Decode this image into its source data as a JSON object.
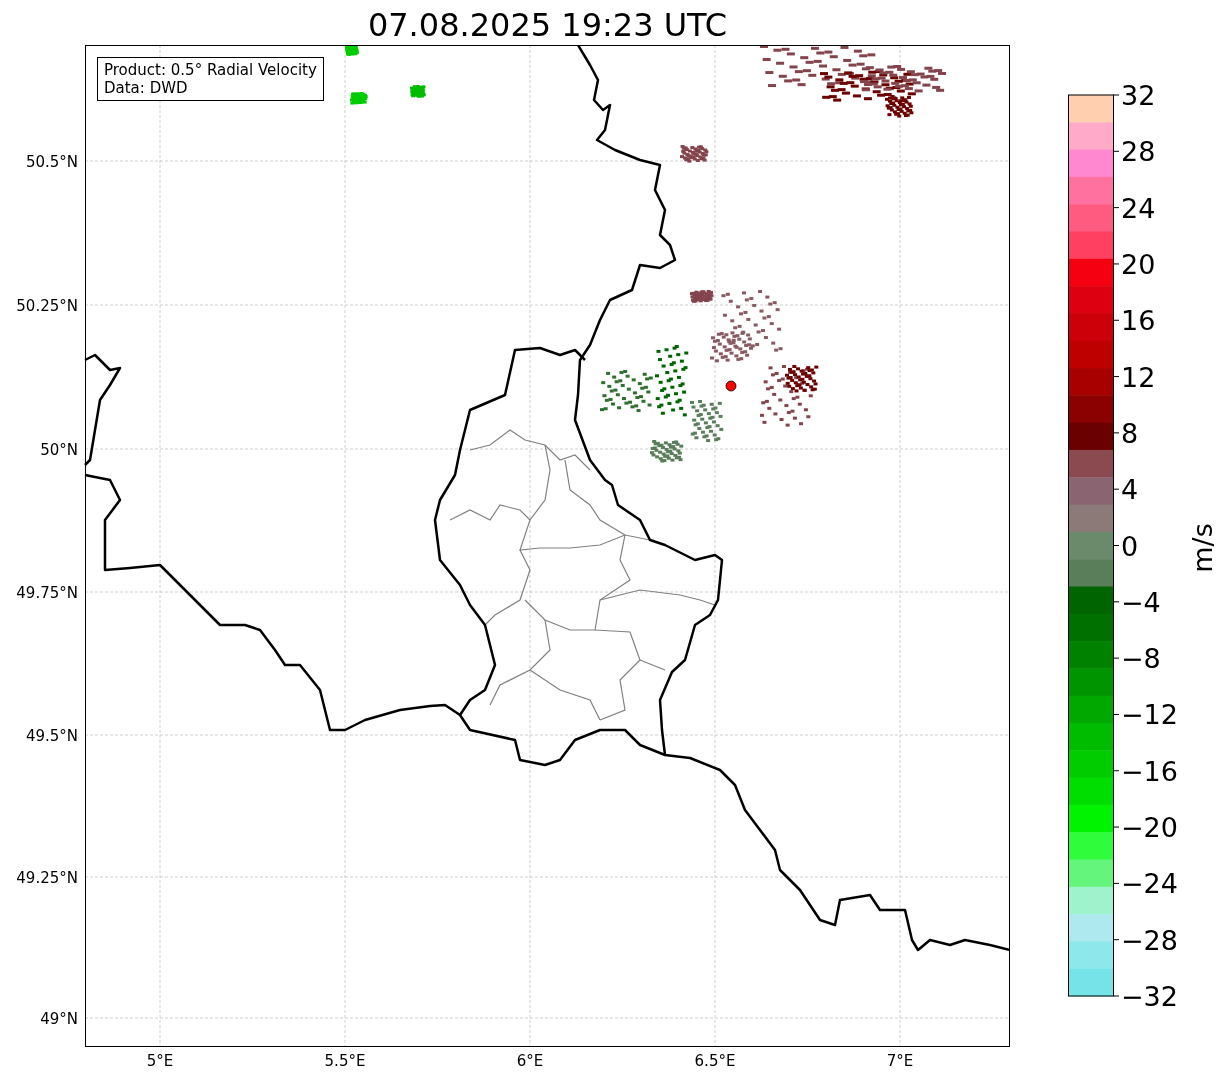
{
  "title": "07.08.2025 19:23 UTC",
  "map": {
    "legend": [
      "Product: 0.5° Radial Velocity",
      "Data: DWD"
    ],
    "lat_ticks": [
      "50.5°N",
      "50.25°N",
      "50°N",
      "49.75°N",
      "49.5°N",
      "49.25°N",
      "49°N"
    ],
    "lon_ticks": [
      "5°E",
      "5.5°E",
      "6°E",
      "6.5°E",
      "7°E"
    ]
  },
  "colorbar": {
    "label": "m/s",
    "ticks": [
      "32",
      "28",
      "24",
      "20",
      "16",
      "12",
      "8",
      "4",
      "0",
      "−4",
      "−8",
      "−12",
      "−16",
      "−20",
      "−24",
      "−28",
      "−32"
    ],
    "bands": [
      {
        "color": "#ffcfb0"
      },
      {
        "color": "#ffaac8"
      },
      {
        "color": "#ff88d0"
      },
      {
        "color": "#ff72a0"
      },
      {
        "color": "#ff5a80"
      },
      {
        "color": "#ff4060"
      },
      {
        "color": "#f50010"
      },
      {
        "color": "#dc0010"
      },
      {
        "color": "#cc0008"
      },
      {
        "color": "#bf0000"
      },
      {
        "color": "#a80000"
      },
      {
        "color": "#8b0000"
      },
      {
        "color": "#6b0000"
      },
      {
        "color": "#8a4a50"
      },
      {
        "color": "#8a6470"
      },
      {
        "color": "#8b7a78"
      },
      {
        "color": "#6b8a6b"
      },
      {
        "color": "#5a7e5a"
      },
      {
        "color": "#006400"
      },
      {
        "color": "#007000"
      },
      {
        "color": "#008200"
      },
      {
        "color": "#009400"
      },
      {
        "color": "#00a800"
      },
      {
        "color": "#00bc00"
      },
      {
        "color": "#00cc00"
      },
      {
        "color": "#00de00"
      },
      {
        "color": "#00f400"
      },
      {
        "color": "#2ffc3a"
      },
      {
        "color": "#64f57c"
      },
      {
        "color": "#9ef2cc"
      },
      {
        "color": "#ade9ee"
      },
      {
        "color": "#8de8eb"
      },
      {
        "color": "#76e3e8"
      }
    ]
  }
}
